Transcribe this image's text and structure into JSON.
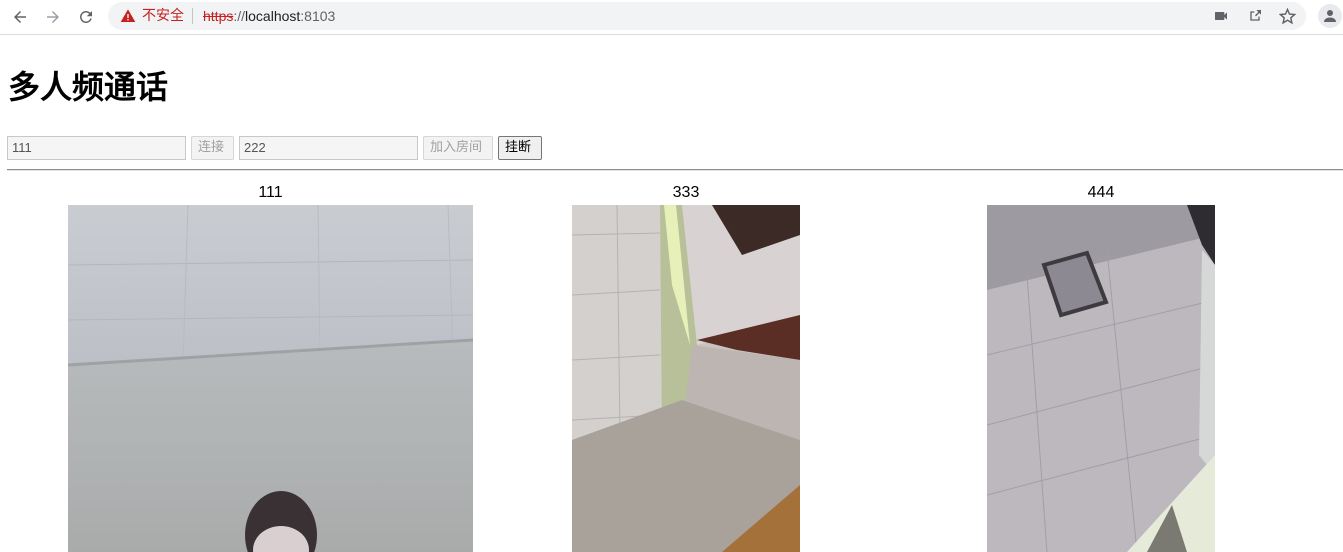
{
  "browser": {
    "security_text": "不安全",
    "url_scheme": "https",
    "url_sep": "://",
    "url_host": "localhost",
    "url_port": ":8103",
    "icons": [
      "back-icon",
      "forward-icon",
      "reload-icon",
      "warning-icon",
      "camera-icon",
      "share-icon",
      "star-icon",
      "profile-icon"
    ]
  },
  "page": {
    "title": "多人频通话"
  },
  "controls": {
    "user_input_value": "111",
    "connect_label": "连接",
    "room_input_value": "222",
    "join_label": "加入房间",
    "hangup_label": "挂断"
  },
  "participants": [
    {
      "name": "111"
    },
    {
      "name": "333"
    },
    {
      "name": "444"
    }
  ]
}
